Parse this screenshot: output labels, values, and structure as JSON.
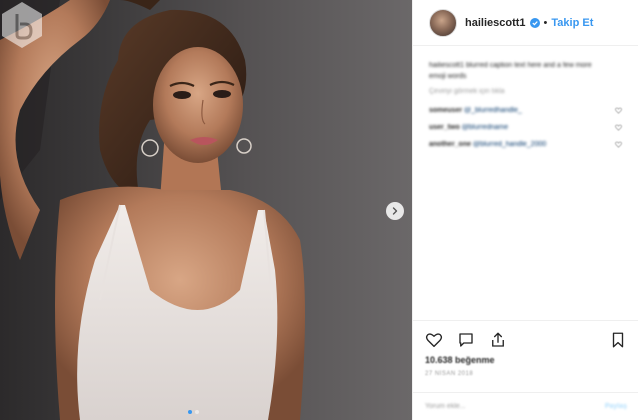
{
  "header": {
    "username": "hailiescott1",
    "separator": "•",
    "follow_label": "Takip Et",
    "verified_icon": "verified-badge-icon"
  },
  "caption": {
    "username": "hailiescott1",
    "text": "hailiescott1 blurred caption text here and a few more emoji words"
  },
  "caption_meta": "Çeviriyi görmek için tıkla",
  "comments": [
    {
      "username": "someuser",
      "text": "@_blurredhandle_"
    },
    {
      "username": "user_two",
      "text": "@blurredname"
    },
    {
      "username": "another_one",
      "text": "@blurred_handle_2000"
    }
  ],
  "likes": "10.638 beğenme",
  "timestamp": "27 NİSAN 2018",
  "add_comment": {
    "placeholder": "Yorum ekle...",
    "post_label": "Paylaş"
  },
  "icons": {
    "like": "heart-icon",
    "comment": "comment-icon",
    "share": "share-icon",
    "save": "bookmark-icon",
    "next": "chevron-right-icon"
  },
  "carousel": {
    "current": 1,
    "total": 2
  },
  "colors": {
    "accent": "#3897f0",
    "text": "#262626",
    "muted": "#999999",
    "border": "#efefef"
  }
}
